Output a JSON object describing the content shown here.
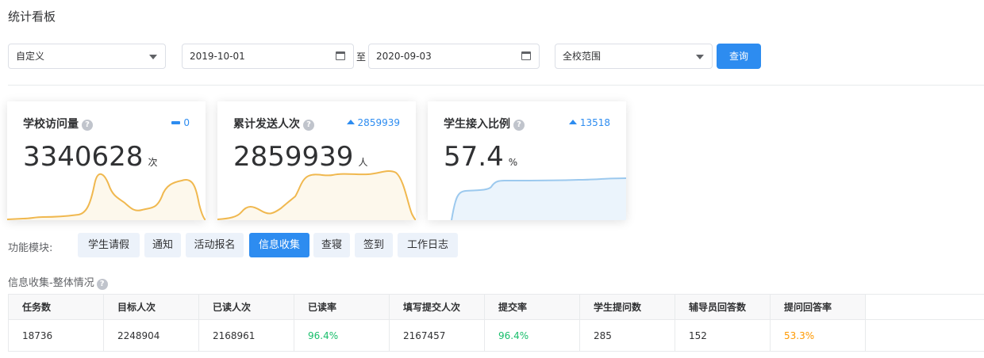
{
  "page_title": "统计看板",
  "filters": {
    "range_type": "自定义",
    "start_date": "2019-10-01",
    "range_separator": "至",
    "end_date": "2020-09-03",
    "scope": "全校范围",
    "query_label": "查询"
  },
  "cards": [
    {
      "title": "学校访问量",
      "trend_icon": "dash-icon",
      "trend": "0",
      "value": "3340628",
      "unit": "次",
      "color": "#f0b84f",
      "fill": "#fdf8ec"
    },
    {
      "title": "累计发送人次",
      "trend_icon": "arrow-up-icon",
      "trend": "2859939",
      "value": "2859939",
      "unit": "人",
      "color": "#f0b84f",
      "fill": "#fdf8ec"
    },
    {
      "title": "学生接入比例",
      "trend_icon": "arrow-up-icon",
      "trend": "13518",
      "value": "57.4",
      "unit": "%",
      "color": "#9cc9ee",
      "fill": "#ebf4fc"
    }
  ],
  "modules": {
    "label": "功能模块:",
    "tabs": [
      "学生请假",
      "通知",
      "活动报名",
      "信息收集",
      "查寝",
      "签到",
      "工作日志"
    ],
    "active_index": 3
  },
  "section": {
    "title": "信息收集-整体情况"
  },
  "table": {
    "headers": [
      "任务数",
      "目标人次",
      "已读人次",
      "已读率",
      "填写提交人次",
      "提交率",
      "学生提问数",
      "辅导员回答数",
      "提问回答率"
    ],
    "row": [
      "18736",
      "2248904",
      "2168961",
      "96.4%",
      "2167457",
      "96.4%",
      "285",
      "152",
      "53.3%"
    ]
  },
  "colors": {
    "primary": "#2d8cf0",
    "success": "#19be6b",
    "warning": "#ff9900"
  }
}
